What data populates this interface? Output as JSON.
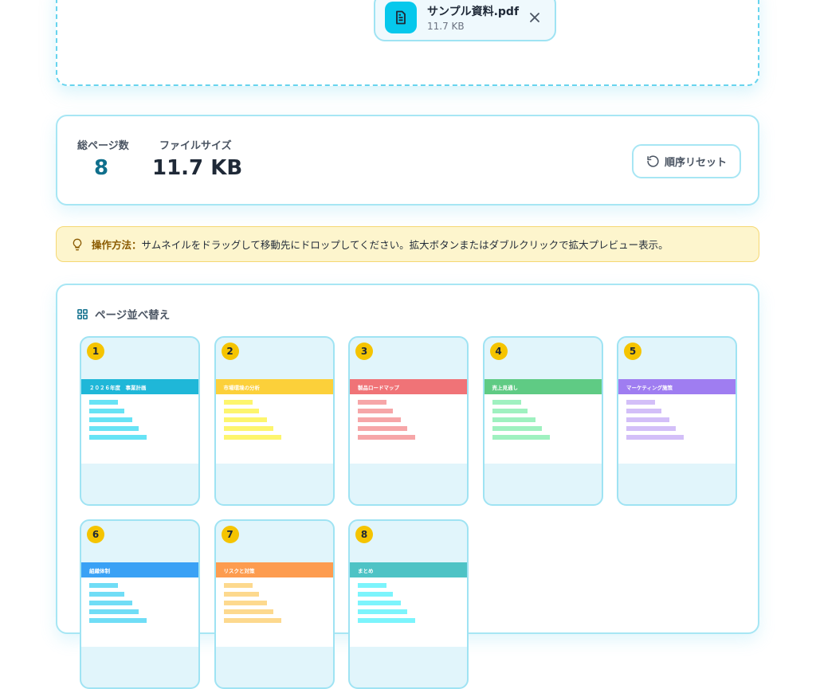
{
  "upload": {
    "file_name": "サンプル資料.pdf",
    "file_size": "11.7 KB",
    "file_icon": "document-icon",
    "close_icon": "close-icon"
  },
  "stats": {
    "total_pages_label": "総ページ数",
    "total_pages_value": "8",
    "file_size_label": "ファイルサイズ",
    "file_size_value": "11.7 KB",
    "reset_label": "順序リセット",
    "reset_icon": "rotate-ccw-icon"
  },
  "info": {
    "icon": "lightbulb-icon",
    "heading": "操作方法：",
    "text": "サムネイルをドラッグして移動先にドロップしてください。拡大ボタンまたはダブルクリックで拡大プレビュー表示。"
  },
  "panel": {
    "title": "ページ並べ替え",
    "icon": "grid-icon",
    "pages": [
      {
        "number": "1",
        "title": "２０２６年度　事業計画",
        "header_color": "#1fb7d8",
        "bar_color": "#67e3f5"
      },
      {
        "number": "2",
        "title": "市場環境の分析",
        "header_color": "#fcd03a",
        "bar_color": "#fdf56d"
      },
      {
        "number": "3",
        "title": "製品ロードマップ",
        "header_color": "#f07377",
        "bar_color": "#f6a6a8"
      },
      {
        "number": "4",
        "title": "売上見通し",
        "header_color": "#5fcb84",
        "bar_color": "#9ff1c0"
      },
      {
        "number": "5",
        "title": "マーケティング施策",
        "header_color": "#9f7df1",
        "bar_color": "#d3bff8"
      },
      {
        "number": "6",
        "title": "組織体制",
        "header_color": "#3aa1f5",
        "bar_color": "#70ddf6"
      },
      {
        "number": "7",
        "title": "リスクと対策",
        "header_color": "#fd9c4f",
        "bar_color": "#fdd98e"
      },
      {
        "number": "8",
        "title": "まとめ",
        "header_color": "#4ec3c5",
        "bar_color": "#7cf4fc"
      }
    ]
  }
}
